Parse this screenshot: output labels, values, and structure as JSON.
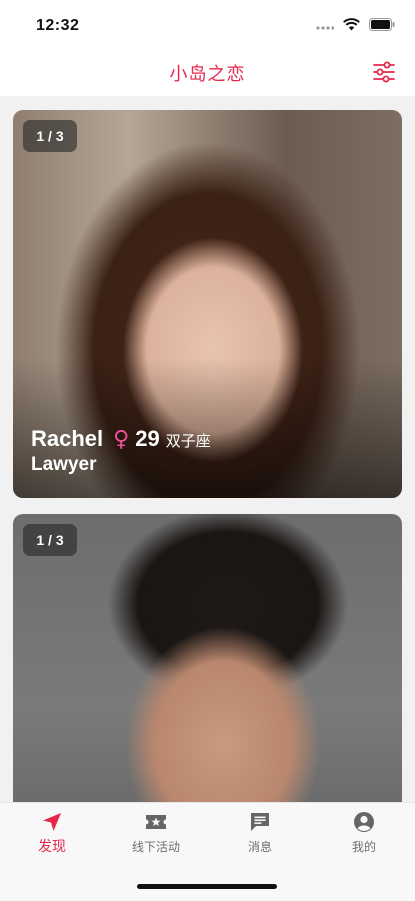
{
  "status_bar": {
    "time": "12:32"
  },
  "header": {
    "title": "小岛之恋"
  },
  "colors": {
    "accent": "#e5284b",
    "gender_female": "#f0509a"
  },
  "icons": {
    "filter": "sliders-icon",
    "tabs": [
      "location-arrow-icon",
      "ticket-star-icon",
      "chat-bubble-icon",
      "user-circle-icon"
    ]
  },
  "cards": [
    {
      "counter": "1 / 3",
      "name": "Rachel",
      "gender_symbol": "♀",
      "age": "29",
      "zodiac": "双子座",
      "job": "Lawyer"
    },
    {
      "counter": "1 / 3"
    }
  ],
  "tabs": [
    {
      "label": "发现",
      "active": true
    },
    {
      "label": "线下活动",
      "active": false
    },
    {
      "label": "消息",
      "active": false
    },
    {
      "label": "我的",
      "active": false
    }
  ]
}
